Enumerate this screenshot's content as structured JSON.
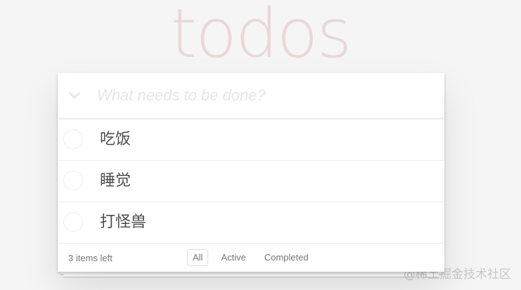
{
  "app": {
    "title": "todos"
  },
  "new_todo": {
    "placeholder": "What needs to be done?",
    "value": ""
  },
  "toggle_all_icon": "chevron-down-icon",
  "todos": [
    {
      "label": "吃饭",
      "completed": false
    },
    {
      "label": "睡觉",
      "completed": false
    },
    {
      "label": "打怪兽",
      "completed": false
    }
  ],
  "footer": {
    "items_left": "3 items left",
    "filters": [
      {
        "label": "All",
        "selected": true
      },
      {
        "label": "Active",
        "selected": false
      },
      {
        "label": "Completed",
        "selected": false
      }
    ]
  },
  "watermark": "@稀土掘金技术社区",
  "colors": {
    "background": "#f5f5f5",
    "title": "rgba(175,47,47,0.15)",
    "selected_filter_border": "rgba(175,47,47,0.2)"
  }
}
